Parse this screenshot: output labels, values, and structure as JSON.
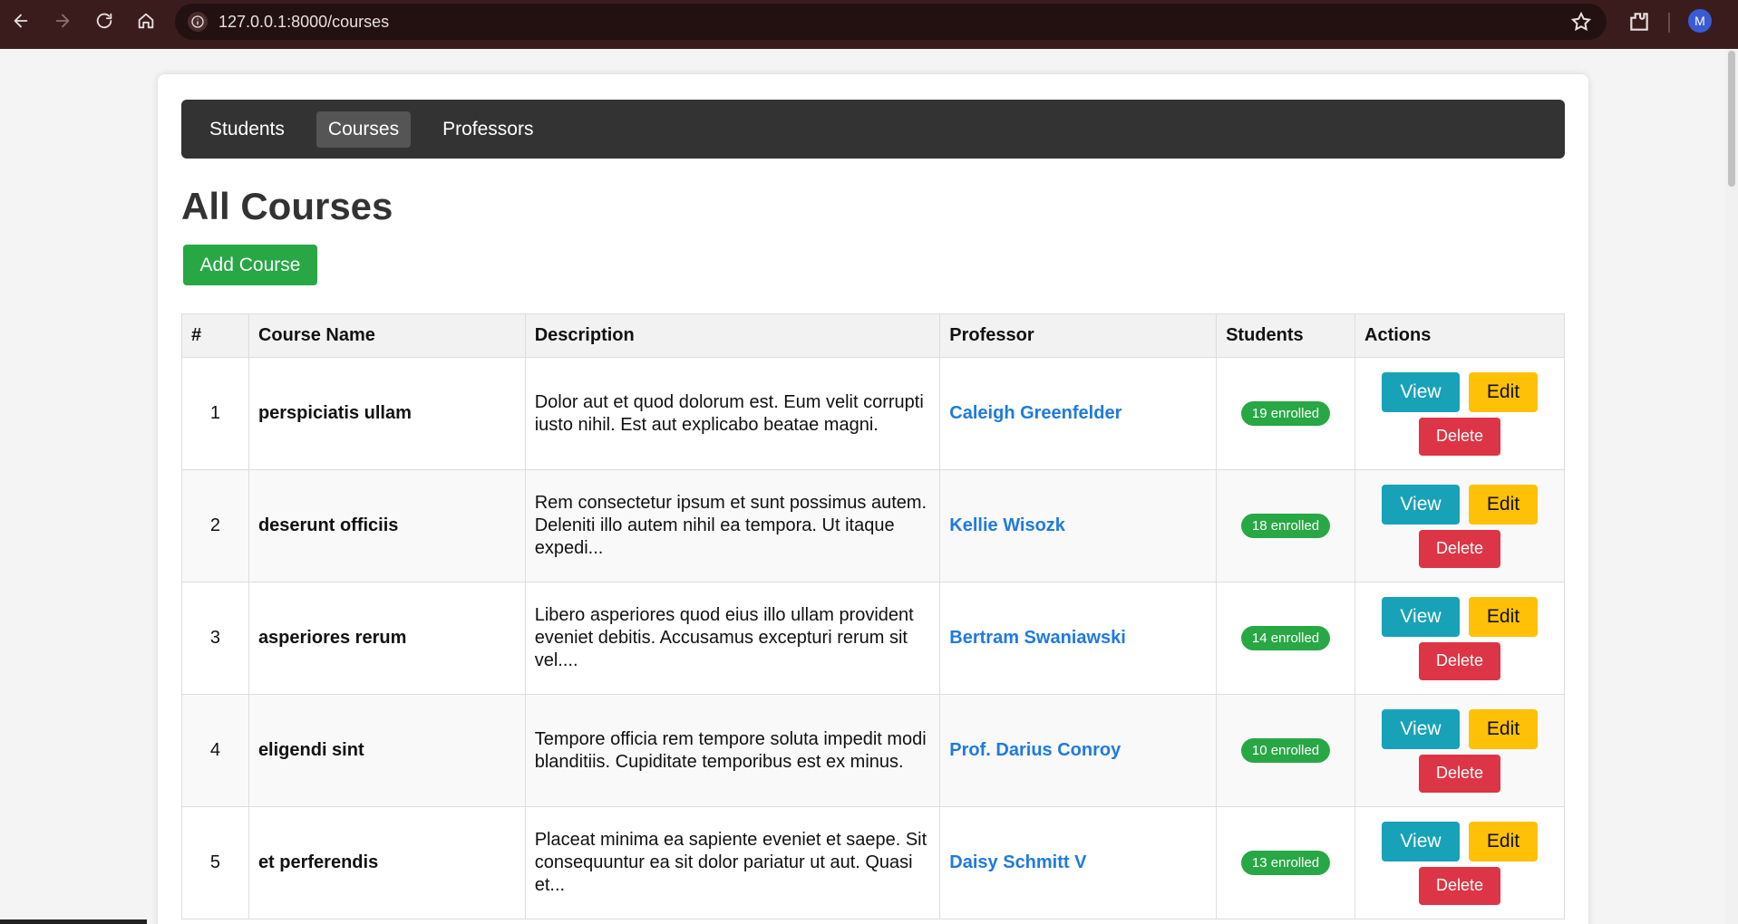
{
  "browser": {
    "url": "127.0.0.1:8000/courses",
    "avatar_letter": "M",
    "icons": [
      "back-icon",
      "forward-icon",
      "reload-icon",
      "home-icon",
      "site-info-icon",
      "star-icon",
      "extensions-icon"
    ]
  },
  "nav": {
    "items": [
      {
        "label": "Students",
        "active": false
      },
      {
        "label": "Courses",
        "active": true
      },
      {
        "label": "Professors",
        "active": false
      }
    ]
  },
  "page": {
    "title": "All Courses",
    "add_button": "Add Course"
  },
  "table": {
    "headers": [
      "#",
      "Course Name",
      "Description",
      "Professor",
      "Students",
      "Actions"
    ],
    "rows": [
      {
        "num": "1",
        "name": "perspiciatis ullam",
        "description": "Dolor aut et quod dolorum est. Eum velit corrupti iusto nihil. Est aut explicabo beatae magni.",
        "professor": "Caleigh Greenfelder",
        "students": "19 enrolled"
      },
      {
        "num": "2",
        "name": "deserunt officiis",
        "description": "Rem consectetur ipsum et sunt possimus autem. Deleniti illo autem nihil ea tempora. Ut itaque expedi...",
        "professor": "Kellie Wisozk",
        "students": "18 enrolled"
      },
      {
        "num": "3",
        "name": "asperiores rerum",
        "description": "Libero asperiores quod eius illo ullam provident eveniet debitis. Accusamus excepturi rerum sit vel....",
        "professor": "Bertram Swaniawski",
        "students": "14 enrolled"
      },
      {
        "num": "4",
        "name": "eligendi sint",
        "description": "Tempore officia rem tempore soluta impedit modi blanditiis. Cupiditate temporibus est ex minus.",
        "professor": "Prof. Darius Conroy",
        "students": "10 enrolled"
      },
      {
        "num": "5",
        "name": "et perferendis",
        "description": "Placeat minima ea sapiente eveniet et saepe. Sit consequuntur ea sit dolor pariatur ut aut. Quasi et...",
        "professor": "Daisy Schmitt V",
        "students": "13 enrolled"
      }
    ],
    "actions": {
      "view": "View",
      "edit": "Edit",
      "delete": "Delete"
    }
  },
  "colors": {
    "navbar": "#333333",
    "add_button": "#28a745",
    "view_button": "#17a2b8",
    "edit_button": "#ffc107",
    "delete_button": "#dc3545",
    "professor_link": "#1e7ae0",
    "badge": "#28a745"
  }
}
